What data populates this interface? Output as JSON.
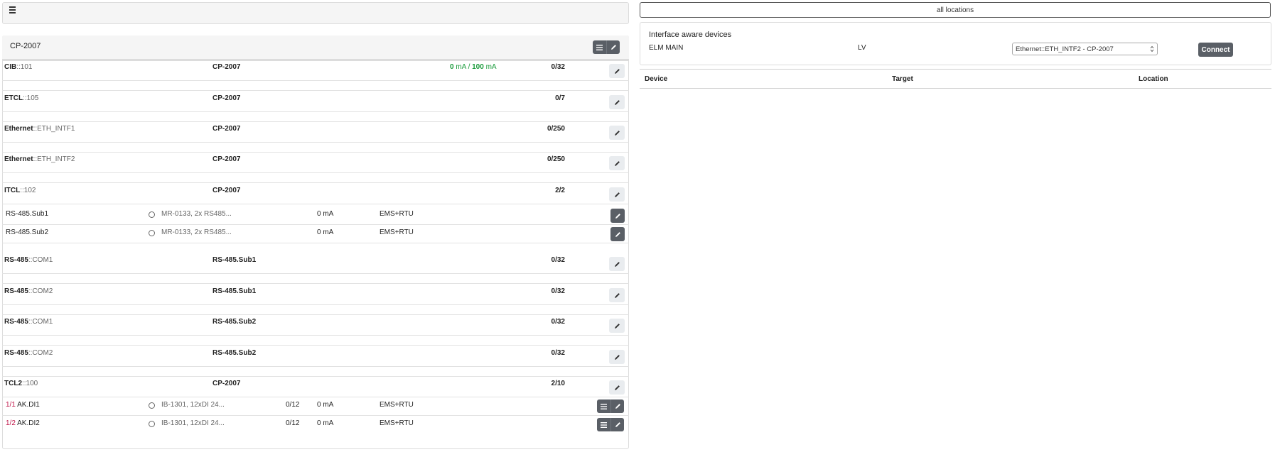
{
  "toolbar": {
    "menu_icon": "hamburger-icon"
  },
  "panel": {
    "title": "CP-2007",
    "rows": [
      {
        "type": "CIB",
        "id": "::101",
        "target": "CP-2007",
        "current_a": "0",
        "current_unit_a": " mA / ",
        "current_b": "100",
        "current_unit_b": " mA",
        "count": "0/32"
      },
      {
        "type": "ETCL",
        "id": "::105",
        "target": "CP-2007",
        "count": "0/7"
      },
      {
        "type": "Ethernet",
        "id": "::ETH_INTF1",
        "target": "CP-2007",
        "count": "0/250"
      },
      {
        "type": "Ethernet",
        "id": "::ETH_INTF2",
        "target": "CP-2007",
        "count": "0/250"
      },
      {
        "type": "ITCL",
        "id": "::102",
        "target": "CP-2007",
        "count": "2/2"
      },
      {
        "type": "RS-485",
        "id": "::COM1",
        "target": "RS-485.Sub1",
        "count": "0/32"
      },
      {
        "type": "RS-485",
        "id": "::COM2",
        "target": "RS-485.Sub1",
        "count": "0/32"
      },
      {
        "type": "RS-485",
        "id": "::COM1",
        "target": "RS-485.Sub2",
        "count": "0/32"
      },
      {
        "type": "RS-485",
        "id": "::COM2",
        "target": "RS-485.Sub2",
        "count": "0/32"
      },
      {
        "type": "TCL2",
        "id": "::100",
        "target": "CP-2007",
        "count": "2/10"
      }
    ],
    "itcl_subs": [
      {
        "name": "RS-485.Sub1",
        "module": "MR-0133, 2x RS485...",
        "current": "0 mA",
        "protocol": "EMS+RTU"
      },
      {
        "name": "RS-485.Sub2",
        "module": "MR-0133, 2x RS485...",
        "current": "0 mA",
        "protocol": "EMS+RTU"
      }
    ],
    "tcl2_subs": [
      {
        "pos": "1/1",
        "name": "AK.DI1",
        "module": "IB-1301, 12xDI 24...",
        "io": "0/12",
        "current": "0 mA",
        "protocol": "EMS+RTU"
      },
      {
        "pos": "1/2",
        "name": "AK.DI2",
        "module": "IB-1301, 12xDI 24...",
        "io": "0/12",
        "current": "0 mA",
        "protocol": "EMS+RTU"
      }
    ]
  },
  "right": {
    "locations_label": "all locations",
    "iface_title": "Interface aware devices",
    "device_name": "ELM MAIN",
    "device_level": "LV",
    "select_value": "Ethernet::ETH_INTF2 - CP-2007",
    "connect_label": "Connect",
    "table_headers": {
      "device": "Device",
      "target": "Target",
      "location": "Location"
    }
  }
}
